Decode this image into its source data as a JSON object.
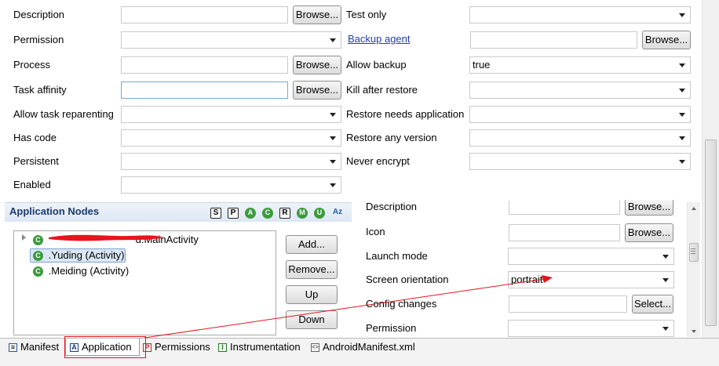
{
  "upper": {
    "left": {
      "description": {
        "label": "Description",
        "value": "",
        "browse": "Browse..."
      },
      "permission": {
        "label": "Permission",
        "value": ""
      },
      "process": {
        "label": "Process",
        "value": "",
        "browse": "Browse..."
      },
      "task_affinity": {
        "label": "Task affinity",
        "value": "",
        "browse": "Browse..."
      },
      "allow_task_reparenting": {
        "label": "Allow task reparenting",
        "value": ""
      },
      "has_code": {
        "label": "Has code",
        "value": ""
      },
      "persistent": {
        "label": "Persistent",
        "value": ""
      },
      "enabled": {
        "label": "Enabled",
        "value": ""
      }
    },
    "right": {
      "test_only": {
        "label": "Test only",
        "value": ""
      },
      "backup_agent": {
        "label": "Backup agent",
        "value": "",
        "browse": "Browse..."
      },
      "allow_backup": {
        "label": "Allow backup",
        "value": "true"
      },
      "kill_after_restore": {
        "label": "Kill after restore",
        "value": ""
      },
      "restore_needs_application": {
        "label": "Restore needs application",
        "value": ""
      },
      "restore_any_version": {
        "label": "Restore any version",
        "value": ""
      },
      "never_encrypt": {
        "label": "Never encrypt",
        "value": ""
      }
    }
  },
  "nodes": {
    "title": "Application Nodes",
    "toolbar": [
      "S",
      "P",
      "A",
      "C",
      "R",
      "M",
      "U",
      "Az"
    ],
    "tree": [
      {
        "label": "com.xxxxx.yyyy.MainActivity",
        "visible_suffix": "d.MainActivity",
        "selected": false
      },
      {
        "label": ".Yuding (Activity)",
        "selected": true
      },
      {
        "label": ".Meiding (Activity)",
        "selected": false
      }
    ],
    "buttons": {
      "add": "Add...",
      "remove": "Remove...",
      "up": "Up",
      "down": "Down"
    }
  },
  "details": {
    "description": {
      "label": "Description",
      "value": "",
      "browse": "Browse..."
    },
    "icon": {
      "label": "Icon",
      "value": "",
      "browse": "Browse..."
    },
    "launch_mode": {
      "label": "Launch mode",
      "value": ""
    },
    "screen_orientation": {
      "label": "Screen orientation",
      "value": "portrait"
    },
    "config_changes": {
      "label": "Config changes",
      "value": "",
      "select": "Select..."
    },
    "permission": {
      "label": "Permission",
      "value": ""
    }
  },
  "tabs": [
    {
      "label": "Manifest",
      "icon": "manifest-icon"
    },
    {
      "label": "Application",
      "icon": "application-icon",
      "active": true
    },
    {
      "label": "Permissions",
      "icon": "permissions-icon"
    },
    {
      "label": "Instrumentation",
      "icon": "instrumentation-icon"
    },
    {
      "label": "AndroidManifest.xml",
      "icon": "xml-file-icon"
    }
  ],
  "colors": {
    "annotation": "#e8141c",
    "section_title": "#1b3b6f",
    "link": "#1f3fa8",
    "activity_icon": "#3c9a3c"
  }
}
